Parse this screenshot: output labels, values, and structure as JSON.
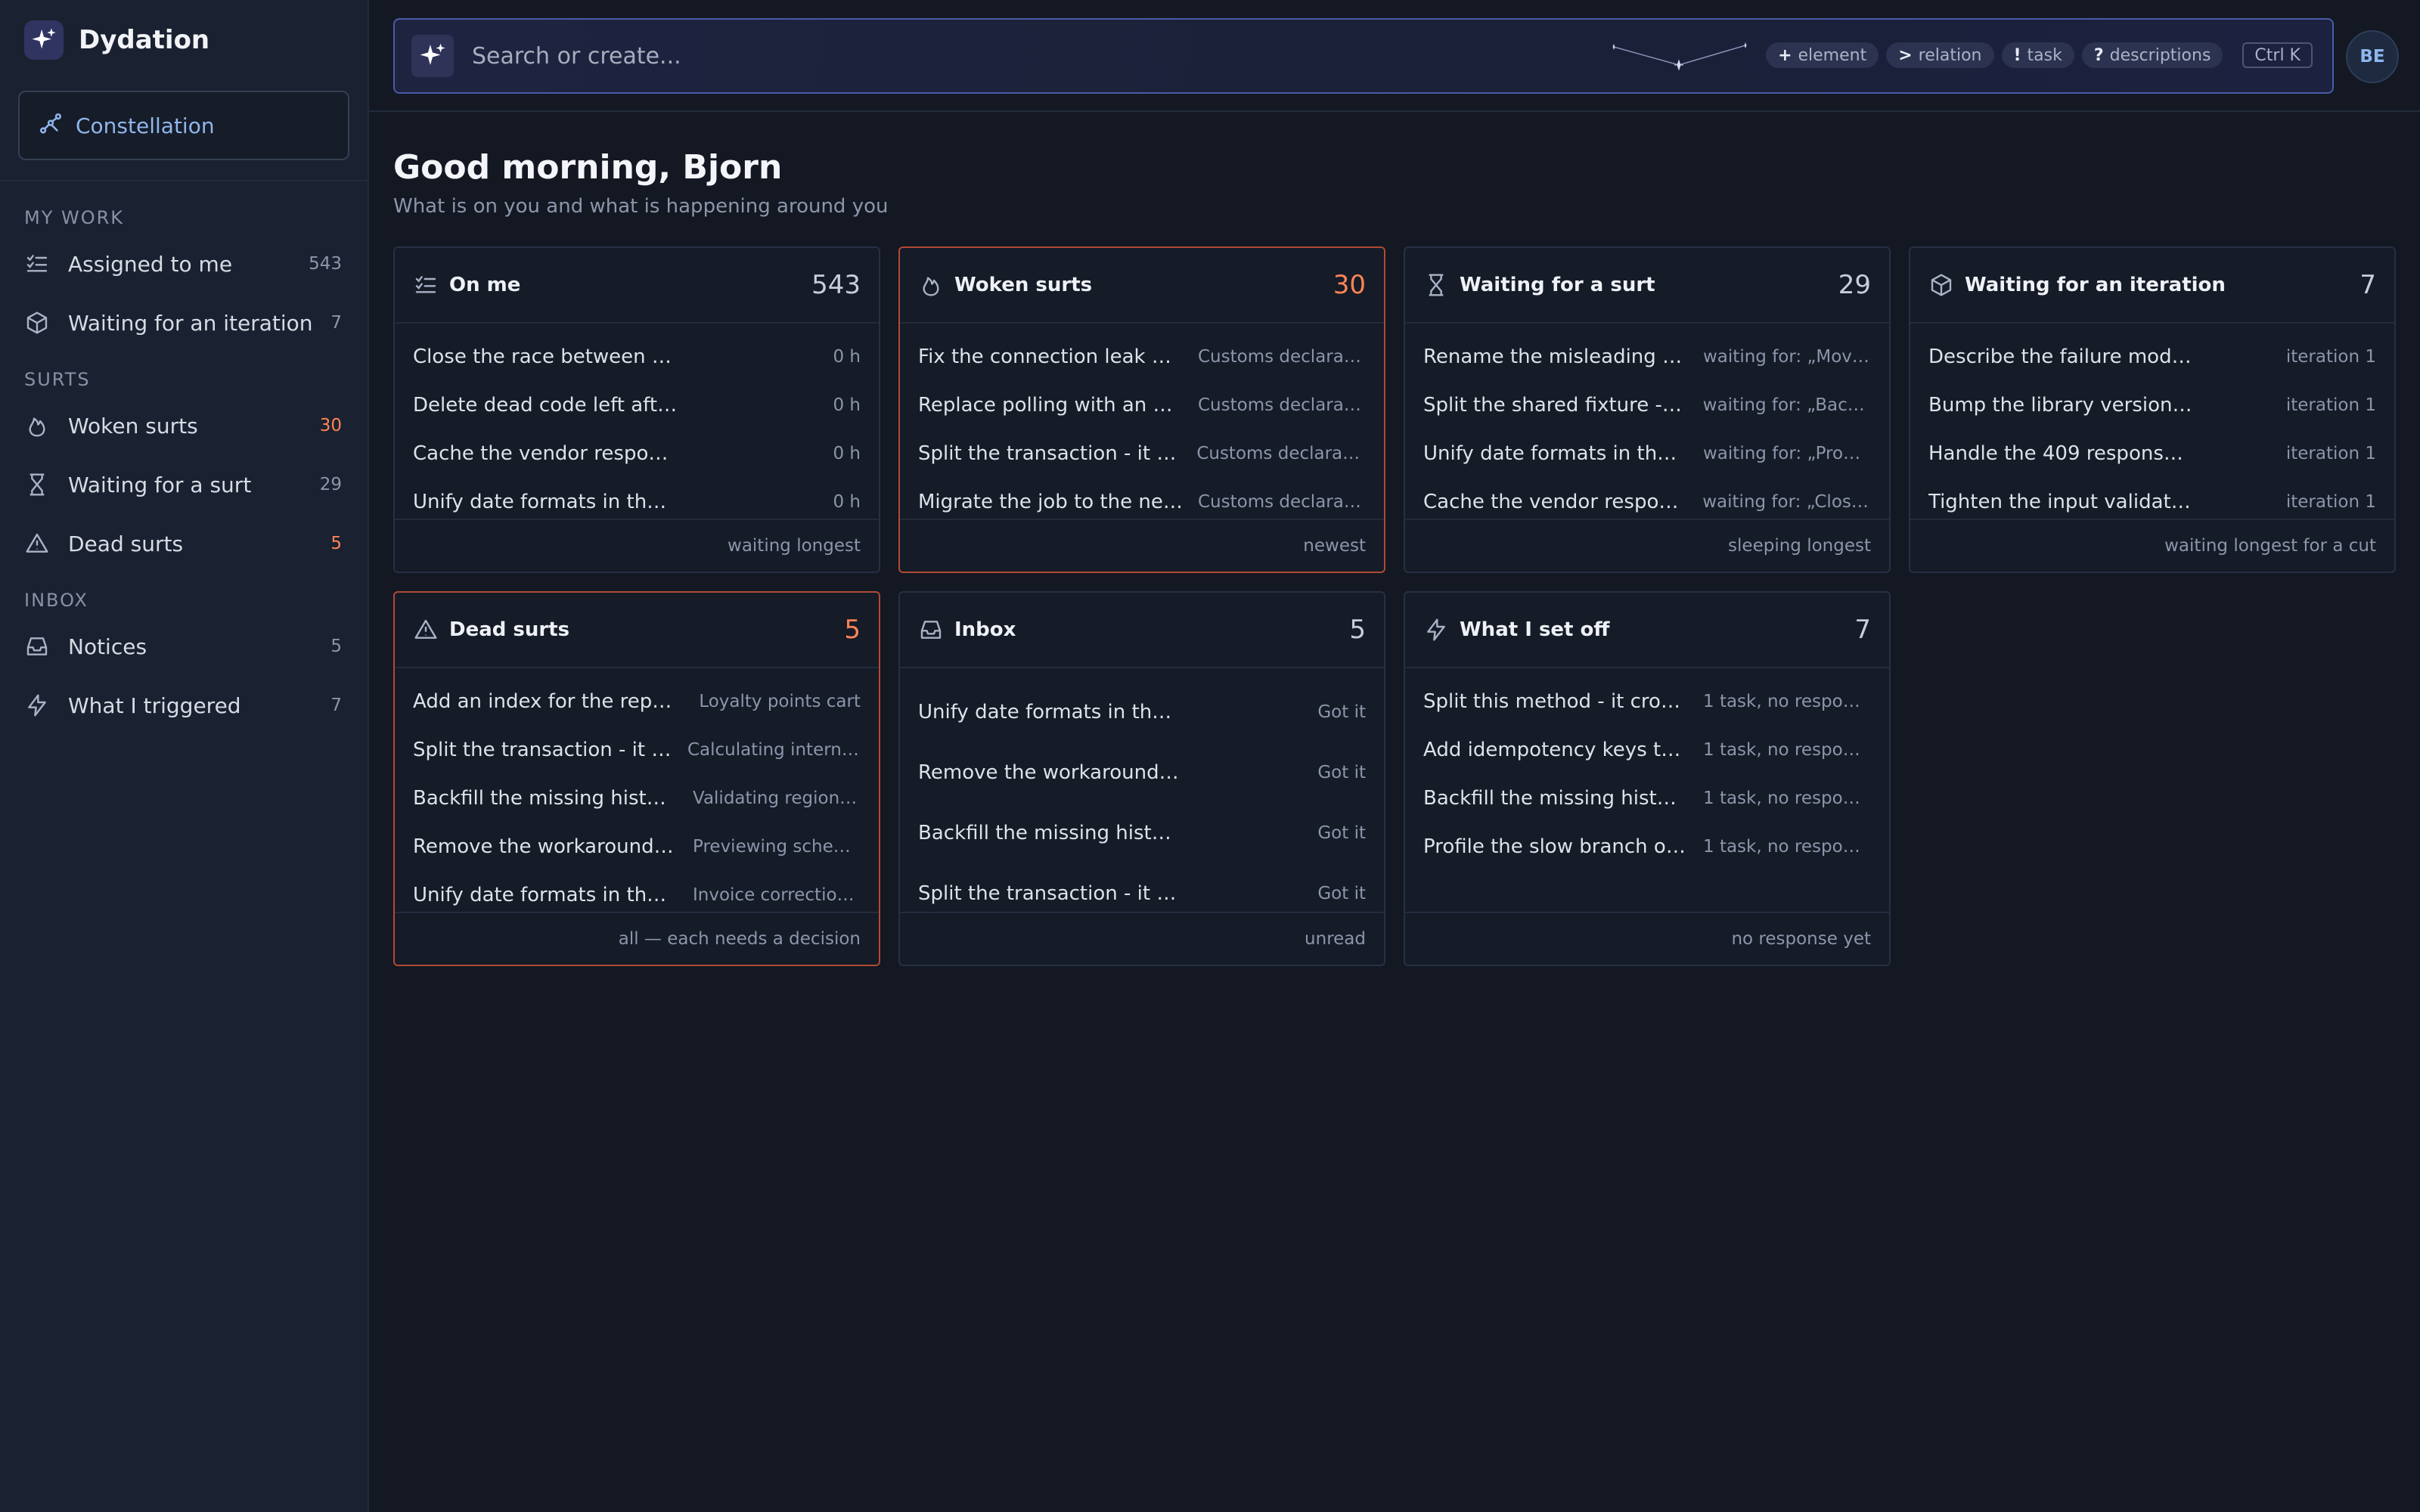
{
  "app": {
    "name": "Dydation"
  },
  "sidebar": {
    "constellation_label": "Constellation",
    "sections": {
      "my_work": "MY WORK",
      "surts": "SURTS",
      "inbox": "INBOX"
    },
    "items": {
      "assigned": {
        "label": "Assigned to me",
        "count": "543",
        "icon": "checklist-icon"
      },
      "waiting_iteration": {
        "label": "Waiting for an iteration",
        "count": "7",
        "icon": "cube-icon"
      },
      "woken": {
        "label": "Woken surts",
        "count": "30",
        "icon": "flame-icon"
      },
      "waiting_surt": {
        "label": "Waiting for a surt",
        "count": "29",
        "icon": "hourglass-icon"
      },
      "dead": {
        "label": "Dead surts",
        "count": "5",
        "icon": "warning-icon"
      },
      "notices": {
        "label": "Notices",
        "count": "5",
        "icon": "inbox-icon"
      },
      "triggered": {
        "label": "What I triggered",
        "count": "7",
        "icon": "bolt-icon"
      }
    }
  },
  "search": {
    "placeholder": "Search or create...",
    "chips": [
      {
        "key": "+",
        "label": "element"
      },
      {
        "key": ">",
        "label": "relation"
      },
      {
        "key": "!",
        "label": "task"
      },
      {
        "key": "?",
        "label": "descriptions"
      }
    ],
    "shortcut": "Ctrl K"
  },
  "user": {
    "initials": "BE"
  },
  "greeting": {
    "title": "Good morning, Bjorn",
    "subtitle": "What is on you and what is happening around you"
  },
  "colors": {
    "accent": "#8fb6ec",
    "alert": "#ff8357",
    "alert_border": "#b04a33",
    "background": "#131823"
  },
  "cards": {
    "on_me": {
      "title": "On me",
      "count": "543",
      "footer": "waiting longest",
      "rows": [
        {
          "text": "Close the race between the ...",
          "meta": "0 h"
        },
        {
          "text": "Delete dead code left after t...",
          "meta": "0 h"
        },
        {
          "text": "Cache the vendor response ...",
          "meta": "0 h"
        },
        {
          "text": "Unify date formats in the res...",
          "meta": "0 h"
        }
      ]
    },
    "woken": {
      "title": "Woken surts",
      "count": "30",
      "footer": "newest",
      "rows": [
        {
          "text": "Fix the connection leak on e...",
          "meta": "Customs declaratio..."
        },
        {
          "text": "Replace polling with an event",
          "meta": "Customs declaratio..."
        },
        {
          "text": "Split the transaction - it hol...",
          "meta": "Customs declaratio..."
        },
        {
          "text": "Migrate the job to the new s...",
          "meta": "Customs declaratio..."
        }
      ]
    },
    "waiting_surt": {
      "title": "Waiting for a surt",
      "count": "29",
      "footer": "sleeping longest",
      "rows": [
        {
          "text": "Rename the misleading flag ...",
          "meta": "waiting for: „Move t..."
        },
        {
          "text": "Split the shared fixture - test...",
          "meta": "waiting for: „Backfill..."
        },
        {
          "text": "Unify date formats in the res...",
          "meta": "waiting for: „Profile ..."
        },
        {
          "text": "Cache the vendor response ...",
          "meta": "waiting for: „Close t..."
        }
      ]
    },
    "waiting_iteration": {
      "title": "Waiting for an iteration",
      "count": "7",
      "footer": "waiting longest for a cut",
      "rows": [
        {
          "text": "Describe the failure modes i...",
          "meta": "iteration 1"
        },
        {
          "text": "Bump the library version - s...",
          "meta": "iteration 1"
        },
        {
          "text": "Handle the 409 response fro...",
          "meta": "iteration 1"
        },
        {
          "text": "Tighten the input validation ...",
          "meta": "iteration 1"
        }
      ]
    },
    "dead": {
      "title": "Dead surts",
      "count": "5",
      "footer": "all — each needs a decision",
      "rows": [
        {
          "text": "Add an index for the reporti...",
          "meta": "Loyalty points cart"
        },
        {
          "text": "Split the transaction - it hol...",
          "meta": "Calculating internal ..."
        },
        {
          "text": "Backfill the missing history r...",
          "meta": "Validating regional ..."
        },
        {
          "text": "Remove the workaround on...",
          "meta": "Previewing schedul..."
        },
        {
          "text": "Unify date formats in the res...",
          "meta": "Invoice corrections ..."
        }
      ]
    },
    "inbox": {
      "title": "Inbox",
      "count": "5",
      "footer": "unread",
      "rows": [
        {
          "text": "Unify date formats in the res...",
          "meta": "Got it"
        },
        {
          "text": "Remove the workaround on...",
          "meta": "Got it"
        },
        {
          "text": "Backfill the missing history r...",
          "meta": "Got it"
        },
        {
          "text": "Split the transaction - it hol...",
          "meta": "Got it"
        }
      ]
    },
    "set_off": {
      "title": "What I set off",
      "count": "7",
      "footer": "no response yet",
      "rows": [
        {
          "text": "Split this method - it crosse...",
          "meta": "1 task, no response"
        },
        {
          "text": "Add idempotency keys to th...",
          "meta": "1 task, no response"
        },
        {
          "text": "Backfill the missing history r...",
          "meta": "1 task, no response"
        },
        {
          "text": "Profile the slow branch of th...",
          "meta": "1 task, no response"
        }
      ]
    }
  }
}
